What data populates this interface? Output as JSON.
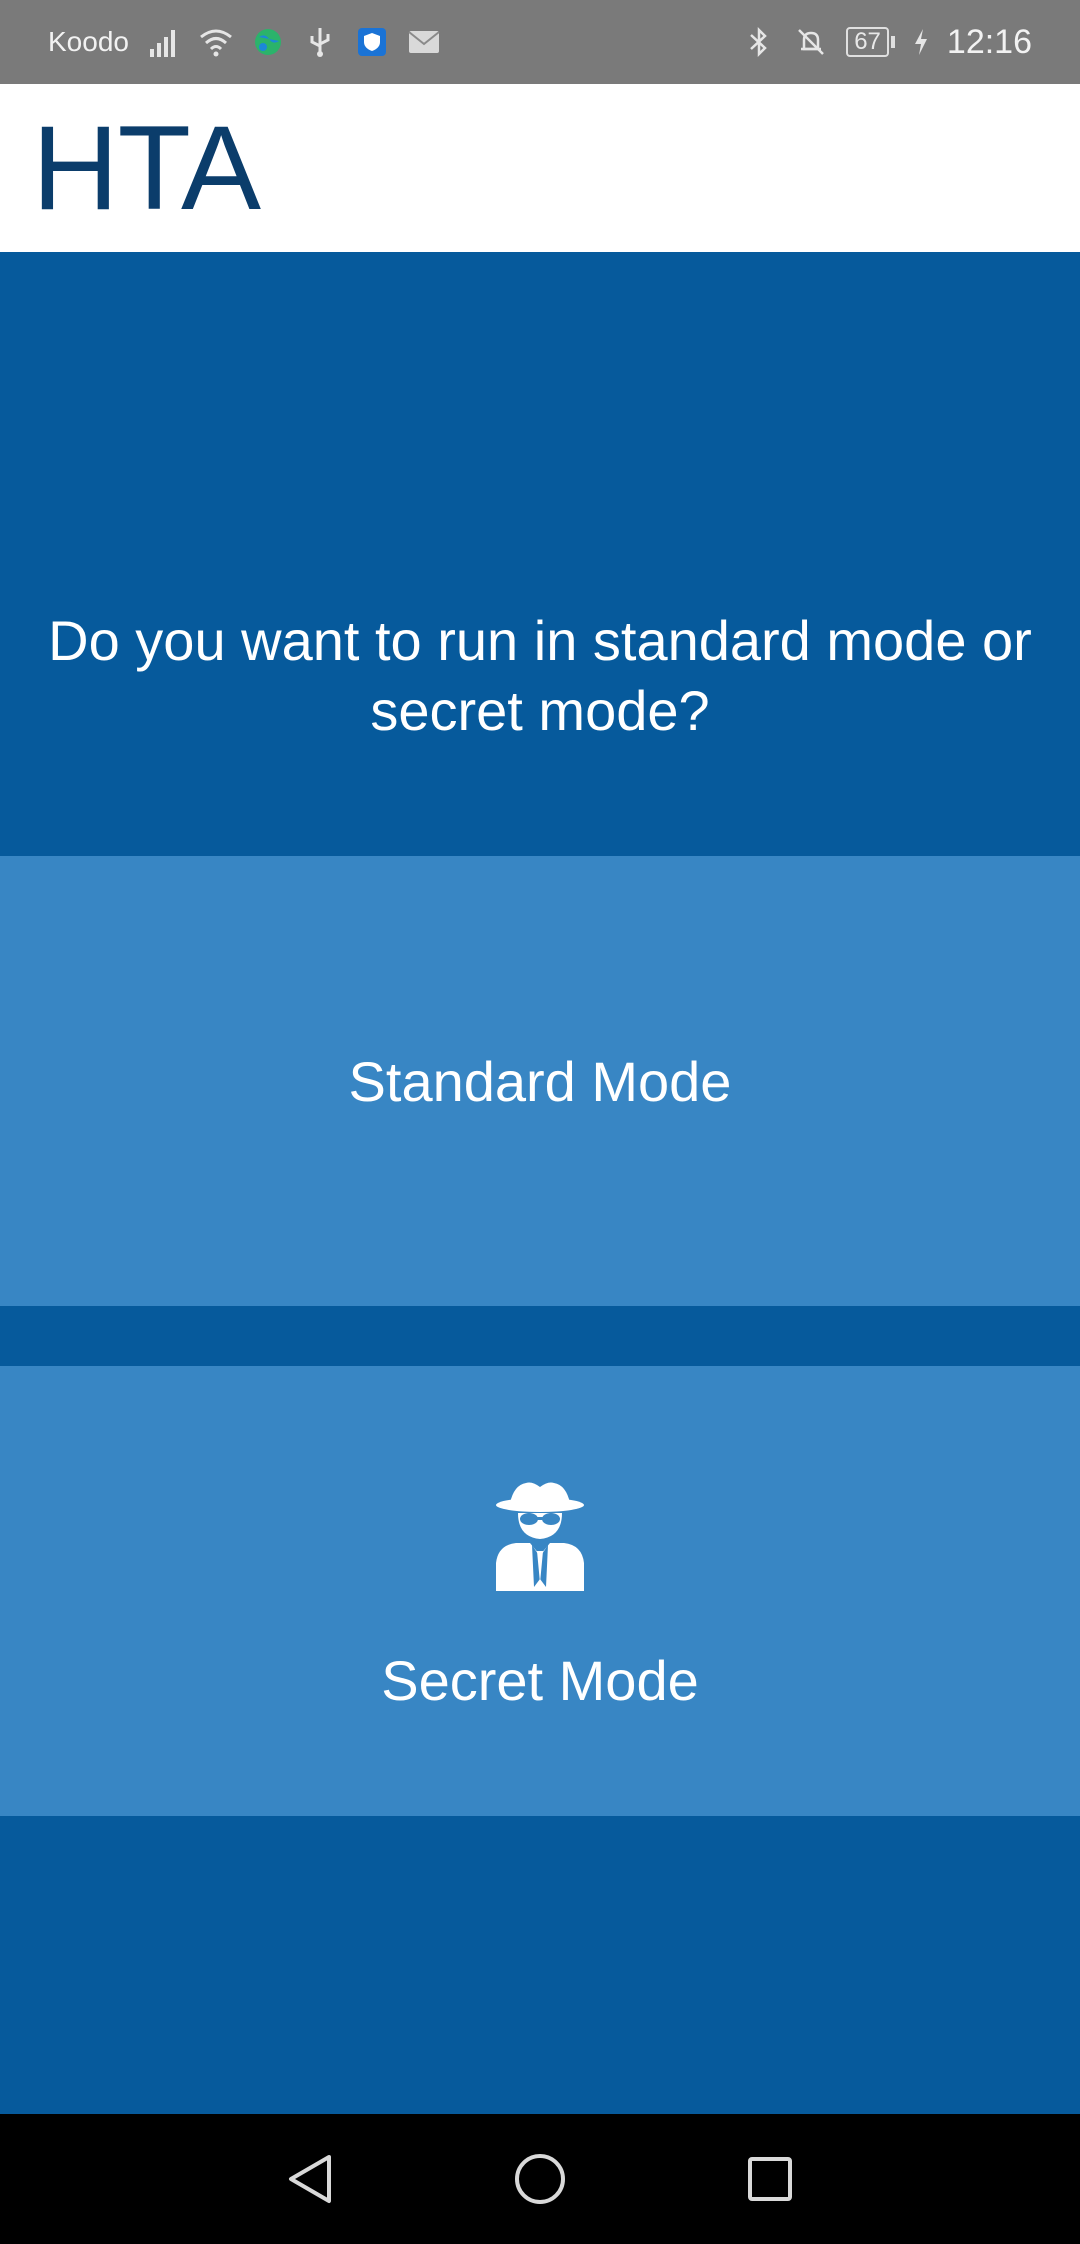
{
  "status_bar": {
    "carrier": "Koodo",
    "battery": "67",
    "time": "12:16",
    "icons": [
      "signal-icon",
      "wifi-icon",
      "globe-icon",
      "usb-icon",
      "shield-icon",
      "mail-icon",
      "bluetooth-icon",
      "bell-off-icon",
      "battery-icon",
      "charging-icon"
    ]
  },
  "header": {
    "title": "HTA"
  },
  "prompt": {
    "text": "Do you want to run in standard mode or secret mode?"
  },
  "buttons": {
    "standard_label": "Standard Mode",
    "secret_label": "Secret Mode",
    "secret_icon": "spy-icon"
  },
  "nav": {
    "icons": [
      "back-icon",
      "home-icon",
      "recents-icon"
    ]
  },
  "colors": {
    "background": "#065a9c",
    "button": "#3886c4",
    "title": "#0b3d6b",
    "status_bar": "#7a7a7a"
  }
}
